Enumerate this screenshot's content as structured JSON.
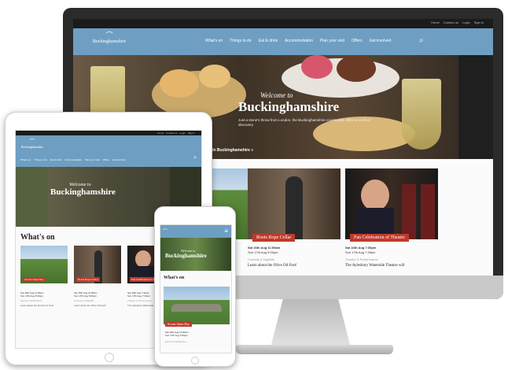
{
  "site": {
    "logo_text": "Buckinghamshire",
    "utility_links": [
      "Home",
      "Contact us",
      "Login",
      "Sign in"
    ]
  },
  "nav": {
    "items": [
      "What's on",
      "Things to do",
      "Eat & drink",
      "Accommodation",
      "Plan your visit",
      "Offers",
      "Get involved"
    ],
    "search_icon": "search-icon",
    "menu_icon": "hamburger-menu-icon"
  },
  "hero": {
    "kicker": "Welcome to",
    "title": "Buckinghamshire",
    "subtitle": "Just a stone's throw from London, the Buckinghamshire countryside offers a world of discovery",
    "link": "What's on in Buckinghamshire »"
  },
  "whats_on": {
    "heading": "What's on",
    "cards": [
      {
        "tag": "Scouts Open Day",
        "date": "Sat 16th Aug 11:00am",
        "venue": "Sun 17th Aug 5:00pm",
        "category": "Events & Exhibitions",
        "desc": "Learn about the Scouts for free!"
      },
      {
        "tag": "Roots Rope Cellar",
        "date": "Sat 16th Aug 11:00am",
        "venue": "Sun 17th Aug 5:00pm",
        "category": "Comedy & Nightlife",
        "desc": "Learn about the Olive Oil Fest!"
      },
      {
        "tag": "Fan Celebration of Theatre",
        "date": "Sat 16th Aug 7:30pm",
        "venue": "Sun 17th Aug 7:30pm",
        "category": "Theatre & Performance",
        "desc": "The Aylesbury Waterside Theatre will"
      }
    ]
  },
  "colors": {
    "nav_blue": "#6e9fc2",
    "tag_red": "#c0392b",
    "bezel_dark": "#2b2b2b"
  }
}
